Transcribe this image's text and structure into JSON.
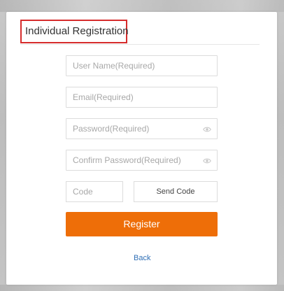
{
  "form": {
    "title": "Individual Registration",
    "username_placeholder": "User Name(Required)",
    "email_placeholder": "Email(Required)",
    "password_placeholder": "Password(Required)",
    "confirm_placeholder": "Confirm Password(Required)",
    "code_placeholder": "Code",
    "send_code_label": "Send Code",
    "register_label": "Register",
    "back_label": "Back"
  },
  "colors": {
    "accent": "#ee6e08",
    "title_highlight": "#d62c2c",
    "link": "#2f6fb6"
  },
  "icons": {
    "password_toggle": "eye-icon",
    "confirm_toggle": "eye-icon"
  }
}
